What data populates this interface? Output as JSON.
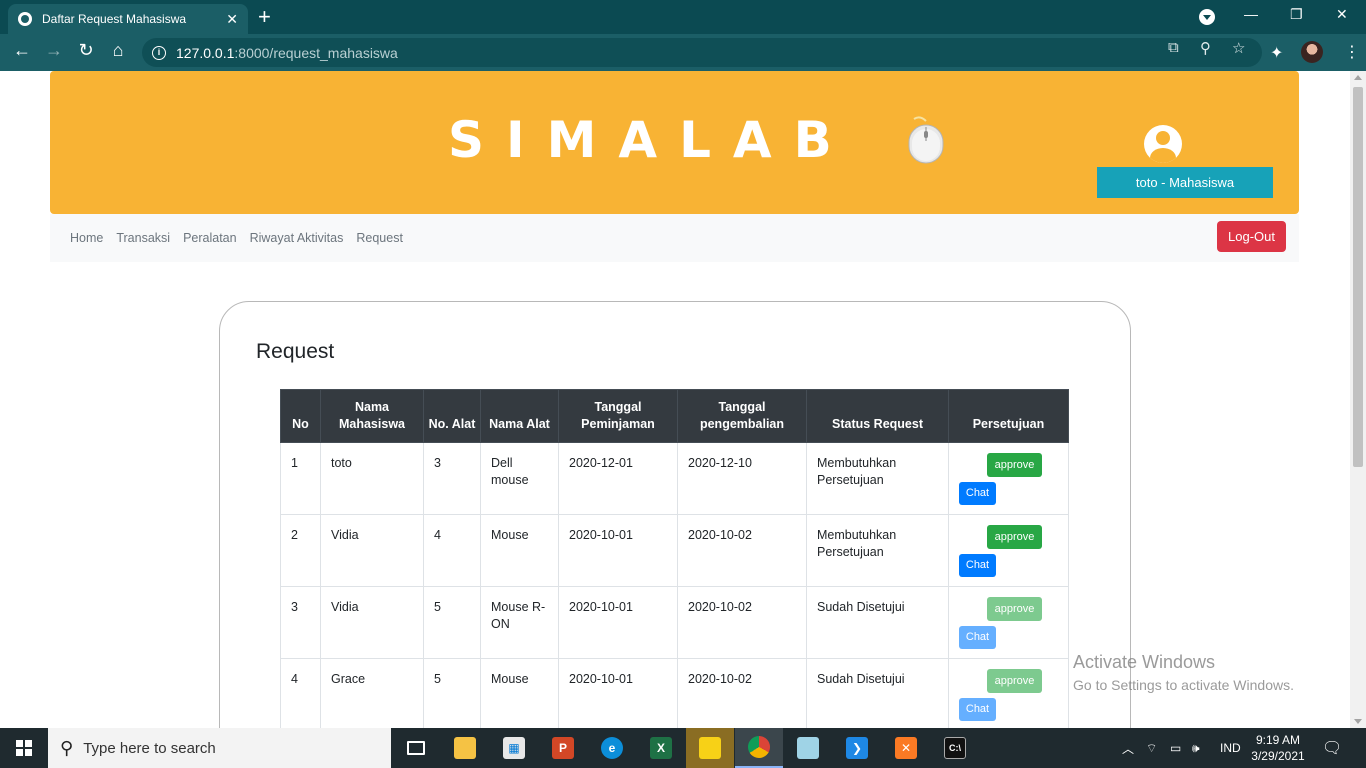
{
  "browser": {
    "tab_title": "Daftar Request Mahasiswa",
    "tab_close": "✕",
    "new_tab": "+",
    "url_host": "127.0.0.1",
    "url_path": ":8000/request_mahasiswa",
    "window_minimize": "—",
    "window_restore": "❐",
    "window_close": "✕"
  },
  "header": {
    "brand": "SIMALAB",
    "user_badge": "toto - Mahasiswa"
  },
  "nav": {
    "links": [
      "Home",
      "Transaksi",
      "Peralatan",
      "Riwayat Aktivitas",
      "Request"
    ],
    "logout": "Log-Out"
  },
  "content": {
    "title": "Request",
    "columns": [
      "No",
      "Nama Mahasiswa",
      "No. Alat",
      "Nama Alat",
      "Tanggal Peminjaman",
      "Tanggal pengembalian",
      "Status Request",
      "Persetujuan"
    ],
    "rows": [
      {
        "no": "1",
        "nama": "toto",
        "no_alat": "3",
        "alat": "Dell mouse",
        "pinjam": "2020-12-01",
        "kembali": "2020-12-10",
        "status": "Membutuhkan Persetujuan",
        "approve": "approve",
        "chat": "Chat"
      },
      {
        "no": "2",
        "nama": "Vidia",
        "no_alat": "4",
        "alat": "Mouse",
        "pinjam": "2020-10-01",
        "kembali": "2020-10-02",
        "status": "Membutuhkan Persetujuan",
        "approve": "approve",
        "chat": "Chat"
      },
      {
        "no": "3",
        "nama": "Vidia",
        "no_alat": "5",
        "alat": "Mouse R-ON",
        "pinjam": "2020-10-01",
        "kembali": "2020-10-02",
        "status": "Sudah Disetujui",
        "approve": "approve",
        "chat": "Chat"
      },
      {
        "no": "4",
        "nama": "Grace",
        "no_alat": "5",
        "alat": "Mouse",
        "pinjam": "2020-10-01",
        "kembali": "2020-10-02",
        "status": "Sudah Disetujui",
        "approve": "approve",
        "chat": "Chat"
      }
    ]
  },
  "watermark": {
    "line1": "Activate Windows",
    "line2": "Go to Settings to activate Windows."
  },
  "taskbar": {
    "search_placeholder": "Type here to search",
    "language": "IND",
    "time": "9:19 AM",
    "date": "3/29/2021"
  },
  "colors": {
    "header_bg": "#f8b334",
    "badge_bg": "#17a2b8",
    "logout_bg": "#dc3545",
    "approve_bg": "#28a745",
    "chat_bg": "#007bff",
    "table_head_bg": "#343a40"
  }
}
